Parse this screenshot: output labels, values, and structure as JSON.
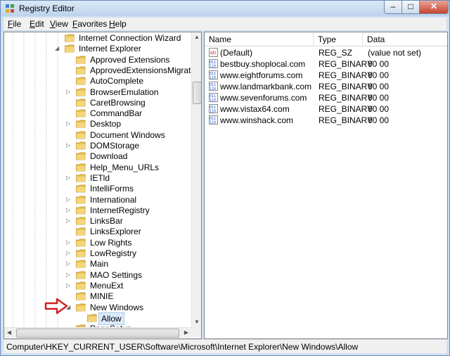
{
  "window": {
    "title": "Registry Editor",
    "minimize_label": "–",
    "maximize_label": "□",
    "close_label": "✕"
  },
  "menu": {
    "file": {
      "u": "F",
      "rest": "ile"
    },
    "edit": {
      "u": "E",
      "rest": "dit"
    },
    "view": {
      "u": "V",
      "rest": "iew"
    },
    "favorites": {
      "u": "F",
      "rest": "avorites"
    },
    "help": {
      "u": "H",
      "rest": "elp"
    }
  },
  "tree": {
    "items": [
      {
        "label": "Internet Connection Wizard",
        "level": 0,
        "expander": ""
      },
      {
        "label": "Internet Explorer",
        "level": 0,
        "expander": "◢"
      },
      {
        "label": "Approved Extensions",
        "level": 1,
        "expander": ""
      },
      {
        "label": "ApprovedExtensionsMigration",
        "level": 1,
        "expander": ""
      },
      {
        "label": "AutoComplete",
        "level": 1,
        "expander": ""
      },
      {
        "label": "BrowserEmulation",
        "level": 1,
        "expander": "▷"
      },
      {
        "label": "CaretBrowsing",
        "level": 1,
        "expander": ""
      },
      {
        "label": "CommandBar",
        "level": 1,
        "expander": ""
      },
      {
        "label": "Desktop",
        "level": 1,
        "expander": "▷"
      },
      {
        "label": "Document Windows",
        "level": 1,
        "expander": ""
      },
      {
        "label": "DOMStorage",
        "level": 1,
        "expander": "▷"
      },
      {
        "label": "Download",
        "level": 1,
        "expander": ""
      },
      {
        "label": "Help_Menu_URLs",
        "level": 1,
        "expander": ""
      },
      {
        "label": "IETld",
        "level": 1,
        "expander": "▷"
      },
      {
        "label": "IntelliForms",
        "level": 1,
        "expander": ""
      },
      {
        "label": "International",
        "level": 1,
        "expander": "▷"
      },
      {
        "label": "InternetRegistry",
        "level": 1,
        "expander": "▷"
      },
      {
        "label": "LinksBar",
        "level": 1,
        "expander": "▷"
      },
      {
        "label": "LinksExplorer",
        "level": 1,
        "expander": ""
      },
      {
        "label": "Low Rights",
        "level": 1,
        "expander": "▷"
      },
      {
        "label": "LowRegistry",
        "level": 1,
        "expander": "▷"
      },
      {
        "label": "Main",
        "level": 1,
        "expander": "▷"
      },
      {
        "label": "MAO Settings",
        "level": 1,
        "expander": "▷"
      },
      {
        "label": "MenuExt",
        "level": 1,
        "expander": "▷"
      },
      {
        "label": "MINIE",
        "level": 1,
        "expander": ""
      },
      {
        "label": "New Windows",
        "level": 1,
        "expander": "◢"
      },
      {
        "label": "Allow",
        "level": 2,
        "expander": "",
        "selected": true
      },
      {
        "label": "PageSetup",
        "level": 1,
        "expander": ""
      }
    ]
  },
  "list": {
    "columns": {
      "name": "Name",
      "type": "Type",
      "data": "Data"
    },
    "rows": [
      {
        "name": "(Default)",
        "type": "REG_SZ",
        "data": "(value not set)",
        "icon": "string-value-icon"
      },
      {
        "name": "bestbuy.shoplocal.com",
        "type": "REG_BINARY",
        "data": "00 00",
        "icon": "binary-value-icon"
      },
      {
        "name": "www.eightforums.com",
        "type": "REG_BINARY",
        "data": "00 00",
        "icon": "binary-value-icon"
      },
      {
        "name": "www.landmarkbank.com",
        "type": "REG_BINARY",
        "data": "00 00",
        "icon": "binary-value-icon"
      },
      {
        "name": "www.sevenforums.com",
        "type": "REG_BINARY",
        "data": "00 00",
        "icon": "binary-value-icon"
      },
      {
        "name": "www.vistax64.com",
        "type": "REG_BINARY",
        "data": "00 00",
        "icon": "binary-value-icon"
      },
      {
        "name": "www.winshack.com",
        "type": "REG_BINARY",
        "data": "00 00",
        "icon": "binary-value-icon"
      }
    ]
  },
  "status": {
    "path": "Computer\\HKEY_CURRENT_USER\\Software\\Microsoft\\Internet Explorer\\New Windows\\Allow"
  },
  "colors": {
    "folder": "#e8c25a",
    "accent": "#7da2ce",
    "annotation_arrow": "#d42020"
  }
}
